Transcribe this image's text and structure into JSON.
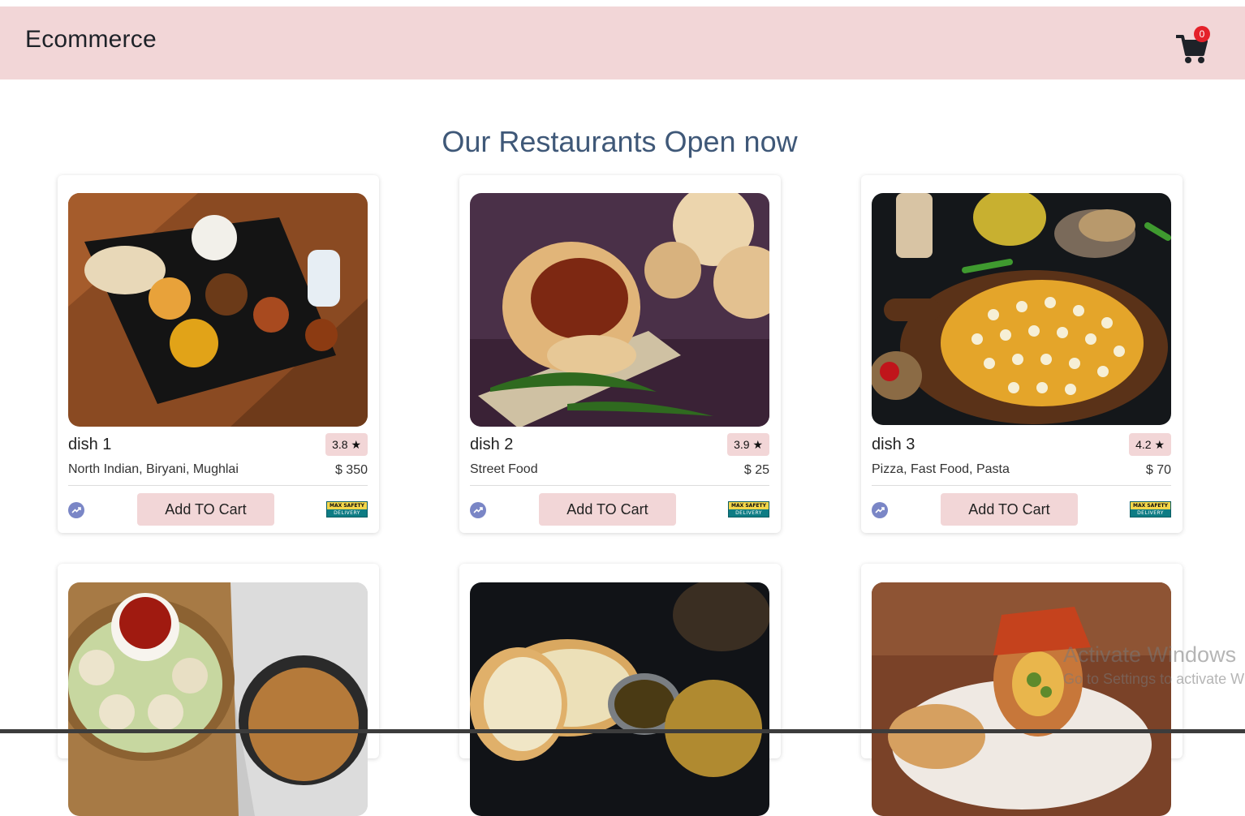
{
  "header": {
    "brand": "Ecommerce",
    "cart_count": "0",
    "cart_icon": "shopping-cart-icon",
    "background": "#f2d6d7"
  },
  "heading": "Our Restaurants Open now",
  "accent_colors": {
    "button": "#f2d6d7",
    "badge": "#e4212a",
    "heading": "#3f5878",
    "trend": "#7a86c6"
  },
  "cards": [
    {
      "name": "dish 1",
      "rating": "3.8 ★",
      "cuisine": "North Indian, Biryani, Mughlai",
      "price": "$ 350",
      "button": "Add TO Cart",
      "safety_badge": [
        "MAX SAFETY",
        "DELIVERY"
      ],
      "image": "thali-plate-photo"
    },
    {
      "name": "dish 2",
      "rating": "3.9 ★",
      "cuisine": "Street Food",
      "price": "$ 25",
      "button": "Add TO Cart",
      "safety_badge": [
        "MAX SAFETY",
        "DELIVERY"
      ],
      "image": "vada-pav-photo"
    },
    {
      "name": "dish 3",
      "rating": "4.2 ★",
      "cuisine": "Pizza, Fast Food, Pasta",
      "price": "$ 70",
      "button": "Add TO Cart",
      "safety_badge": [
        "MAX SAFETY",
        "DELIVERY"
      ],
      "image": "pizza-photo"
    },
    {
      "image": "momos-noodles-photo"
    },
    {
      "image": "naan-curry-photo"
    },
    {
      "image": "wrap-roll-photo"
    }
  ],
  "watermark": {
    "line1": "Activate Windows",
    "line2": "Go to Settings to activate Windows."
  }
}
